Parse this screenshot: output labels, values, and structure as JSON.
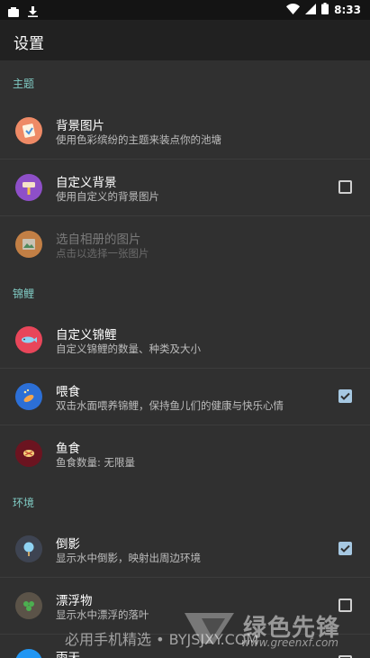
{
  "status_bar": {
    "time": "8:33"
  },
  "app_bar": {
    "title": "设置"
  },
  "sections": {
    "theme": "主题",
    "koi": "锦鲤",
    "environment": "环境"
  },
  "prefs": {
    "background_image": {
      "title": "背景图片",
      "summary": "使用色彩缤纷的主题来装点你的池塘"
    },
    "custom_background": {
      "title": "自定义背景",
      "summary": "使用自定义的背景图片",
      "checked": false
    },
    "pick_from_album": {
      "title": "选自相册的图片",
      "summary": "点击以选择一张图片",
      "enabled": false
    },
    "custom_koi": {
      "title": "自定义锦鲤",
      "summary": "自定义锦鲤的数量、种类及大小"
    },
    "feeding": {
      "title": "喂食",
      "summary": "双击水面喂养锦鲤，保持鱼儿们的健康与快乐心情",
      "checked": true
    },
    "fish_food": {
      "title": "鱼食",
      "summary": "鱼食数量: 无限量"
    },
    "reflection": {
      "title": "倒影",
      "summary": "显示水中倒影，映射出周边环境",
      "checked": true
    },
    "floating": {
      "title": "漂浮物",
      "summary": "显示水中漂浮的落叶",
      "checked": false
    },
    "rain": {
      "title": "雨天"
    }
  },
  "watermark": {
    "text": "必用手机精选 • BYJSJXY.COM",
    "brand": "绿色先锋",
    "url": "www.greenxf.com"
  },
  "colors": {
    "accent": "#80cbc4",
    "checkbox_checked": "#a6c8e2",
    "background": "#303030"
  }
}
